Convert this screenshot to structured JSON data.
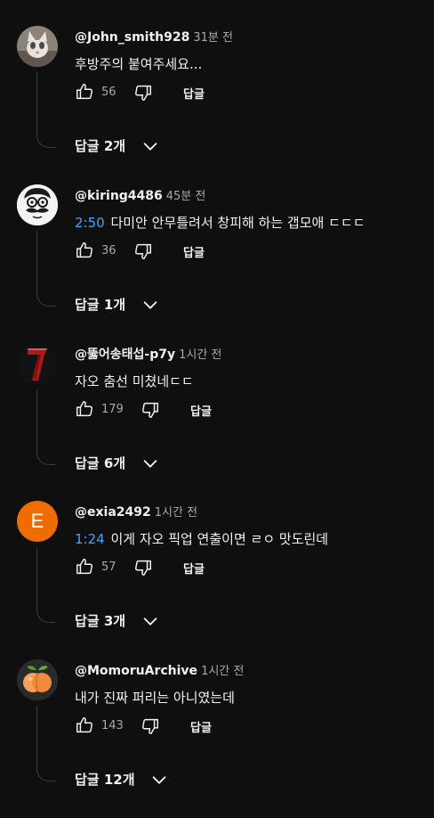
{
  "ui": {
    "reply_label": "답글"
  },
  "comments": [
    {
      "author": "@John_smith928",
      "time": "31분 전",
      "timestamp": "",
      "text": "후방주의 붙여주세요...",
      "likes": "56",
      "replies_label": "답글 2개",
      "avatar_icon": "cat-photo-icon"
    },
    {
      "author": "@kiring4486",
      "time": "45분 전",
      "timestamp": "2:50",
      "text": "다미안 안무틀려서 창피해 하는 갭모애 ㄷㄷㄷ",
      "likes": "36",
      "replies_label": "답글 1개",
      "avatar_icon": "mustache-cartoon-icon"
    },
    {
      "author": "@뚫어송태섭-p7y",
      "time": "1시간 전",
      "timestamp": "",
      "text": "자오 춤선 미쳤네ㄷㄷ",
      "likes": "179",
      "replies_label": "답글 6개",
      "avatar_icon": "number-seven-icon"
    },
    {
      "author": "@exia2492",
      "time": "1시간 전",
      "timestamp": "1:24",
      "text": "이게 자오 픽업 연출이면 ㄹㅇ 맛도린데",
      "likes": "57",
      "replies_label": "답글 3개",
      "avatar_letter": "E",
      "avatar_color": "#ef6c00"
    },
    {
      "author": "@MomoruArchive",
      "time": "1시간 전",
      "timestamp": "",
      "text": "내가 진짜 퍼리는 아니였는데",
      "likes": "143",
      "replies_label": "답글 12개",
      "avatar_icon": "peach-icon"
    }
  ]
}
